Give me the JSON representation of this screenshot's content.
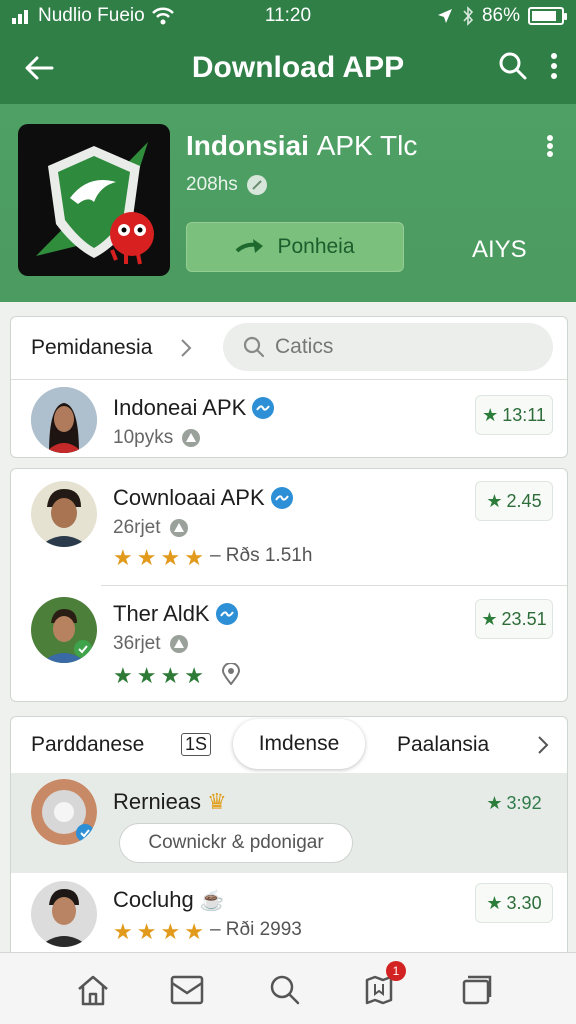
{
  "status_bar": {
    "carrier": "Nudlio Fueio",
    "time": "11:20",
    "battery": "86%",
    "battery_level": 0.86
  },
  "app_bar": {
    "title": "Download APP"
  },
  "hero": {
    "app_name_bold": "Indonsiai",
    "app_name_rest": "APK Tlc",
    "meta": "208hs",
    "install_label": "Ponheia",
    "secondary_label": "AIYS"
  },
  "filter": {
    "title": "Pemidanesia",
    "search_placeholder": "Catics"
  },
  "list1": [
    {
      "name": "Indoneai APK",
      "sub": "10pyks",
      "rating": "13:11"
    }
  ],
  "list2": [
    {
      "name": "Cownloaai APK",
      "sub": "26rjet",
      "rating": "2.45",
      "stars_label": "– Rðs 1.51h",
      "stars_filled": 4
    },
    {
      "name": "Ther AldK",
      "sub": "36rjet",
      "rating": "23.51",
      "stars_filled": 4
    }
  ],
  "tabs": {
    "first": "Parddanese",
    "count": "1S",
    "selected": "Imdense",
    "third": "Paalansia"
  },
  "list3": [
    {
      "name": "Rernieas",
      "rating": "3:92",
      "chip": "Cownickr & pdonigar"
    },
    {
      "name": "Cocluhg",
      "stars_label": "– Rði 2993",
      "rating": "3.30",
      "stars_filled": 4
    }
  ],
  "bottom_nav": {
    "badge": "1"
  },
  "colors": {
    "brand": "#2f7f47",
    "hero": "#4ea064",
    "accent_star": "#e29a1c",
    "verified": "#2d8fd5"
  }
}
